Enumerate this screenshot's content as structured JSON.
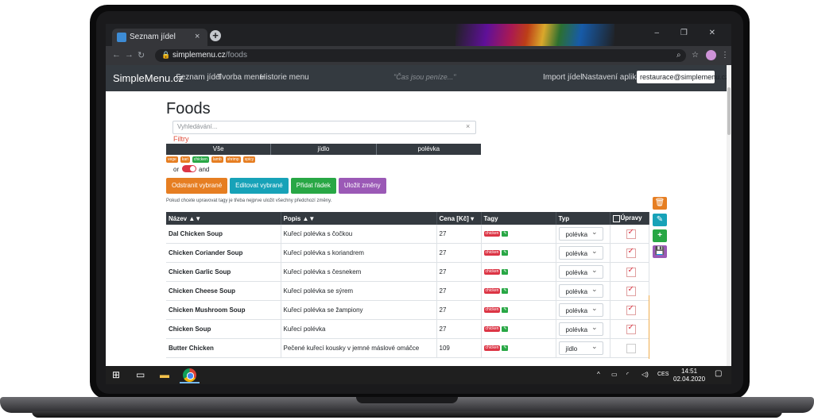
{
  "browser": {
    "tab_title": "Seznam jídel",
    "tab_close": "×",
    "new_tab": "+",
    "url_host": "simplemenu.cz",
    "url_path": "/foods",
    "window_controls": "– ❐ ✕"
  },
  "navbar": {
    "brand": "SimpleMenu.cz",
    "links": [
      "Seznam jídel",
      "Tvorba menu",
      "Historie menu"
    ],
    "slogan": "\"Čas jsou peníze...\"",
    "right_links": [
      "Import jídel",
      "Nastavení aplikace"
    ],
    "user": "restaurace@simplemenu.cz ▾"
  },
  "page": {
    "title": "Foods",
    "search_placeholder": "Vyhledávání...",
    "search_clear": "×",
    "filters_label": "Filtry",
    "categories": [
      "Vše",
      "jídlo",
      "polévka"
    ],
    "filter_tags": [
      "vege",
      "kari",
      "chicken",
      "lamb",
      "shrimp",
      "spicy"
    ],
    "or_label": "or",
    "and_label": "and",
    "buttons": {
      "remove": "Odstranit vybrané",
      "edit": "Editovat vybrané",
      "add_row": "Přidat řádek",
      "save": "Uložit změny"
    },
    "hint": "Pokud chcete upravovat tagy je třeba nejprve uložit všechny předchozí změny."
  },
  "table": {
    "headers": {
      "name": "Název ▲▼",
      "desc": "Popis ▲▼",
      "price": "Cena [Kč] ▾",
      "tags": "Tagy",
      "type": "Typ",
      "edit": "Úpravy"
    },
    "rows": [
      {
        "name": "Dal Chicken Soup",
        "desc": "Kuřecí polévka s čočkou",
        "price": "27",
        "tag": "chicken",
        "type": "polévka",
        "checked": true
      },
      {
        "name": "Chicken Coriander Soup",
        "desc": "Kuřecí polévka s koriandrem",
        "price": "27",
        "tag": "chicken",
        "type": "polévka",
        "checked": true
      },
      {
        "name": "Chicken Garlic Soup",
        "desc": "Kuřecí polévka s česnekem",
        "price": "27",
        "tag": "chicken",
        "type": "polévka",
        "checked": true
      },
      {
        "name": "Chicken Cheese Soup",
        "desc": "Kuřecí polévka se sýrem",
        "price": "27",
        "tag": "chicken",
        "type": "polévka",
        "checked": true
      },
      {
        "name": "Chicken Mushroom Soup",
        "desc": "Kuřecí polévka se žampiony",
        "price": "27",
        "tag": "chicken",
        "type": "polévka",
        "checked": true
      },
      {
        "name": "Chicken Soup",
        "desc": "Kuřecí polévka",
        "price": "27",
        "tag": "chicken",
        "type": "polévka",
        "checked": true
      },
      {
        "name": "Butter Chicken",
        "desc": "Pečené kuřecí kousky v jemné máslové omáčce",
        "price": "109",
        "tag": "chicken",
        "type": "jídlo",
        "checked": false
      }
    ]
  },
  "side_buttons": [
    "🗑",
    "✎",
    "+",
    "💾"
  ],
  "taskbar": {
    "lang": "CES",
    "time": "14:51",
    "date": "02.04.2020"
  },
  "colors": {
    "navbar_bg": "#343a40",
    "remove_btn": "#e67e22",
    "edit_btn": "#17a2b8",
    "add_btn": "#28a745",
    "save_btn": "#9b59b6",
    "tag_chicken": "#dc3545"
  }
}
